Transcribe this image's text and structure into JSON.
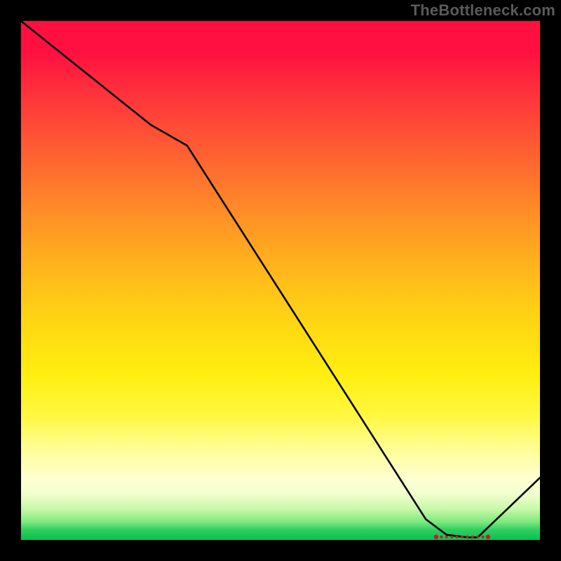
{
  "watermark": "TheBottleneck.com",
  "chart_data": {
    "type": "line",
    "title": "",
    "xlabel": "",
    "ylabel": "",
    "xlim": [
      0,
      100
    ],
    "ylim": [
      0,
      100
    ],
    "series": [
      {
        "name": "curve",
        "x": [
          0,
          10,
          25,
          32,
          78,
          82,
          86,
          88,
          100
        ],
        "y": [
          100,
          92,
          80,
          76,
          4,
          1,
          0.5,
          0.5,
          12
        ]
      }
    ],
    "markers": {
      "name": "optimal-band",
      "x": [
        80,
        81,
        82,
        83,
        84,
        85,
        86,
        87,
        88,
        89,
        90
      ],
      "y": [
        0.6,
        0.6,
        0.6,
        0.6,
        0.6,
        0.6,
        0.6,
        0.6,
        0.6,
        0.6,
        0.6
      ]
    },
    "background_gradient": {
      "orientation": "vertical",
      "stops": [
        {
          "pos": 0,
          "color": "#ff1041"
        },
        {
          "pos": 50,
          "color": "#ffc418"
        },
        {
          "pos": 85,
          "color": "#fffd90"
        },
        {
          "pos": 100,
          "color": "#0abf50"
        }
      ]
    }
  }
}
